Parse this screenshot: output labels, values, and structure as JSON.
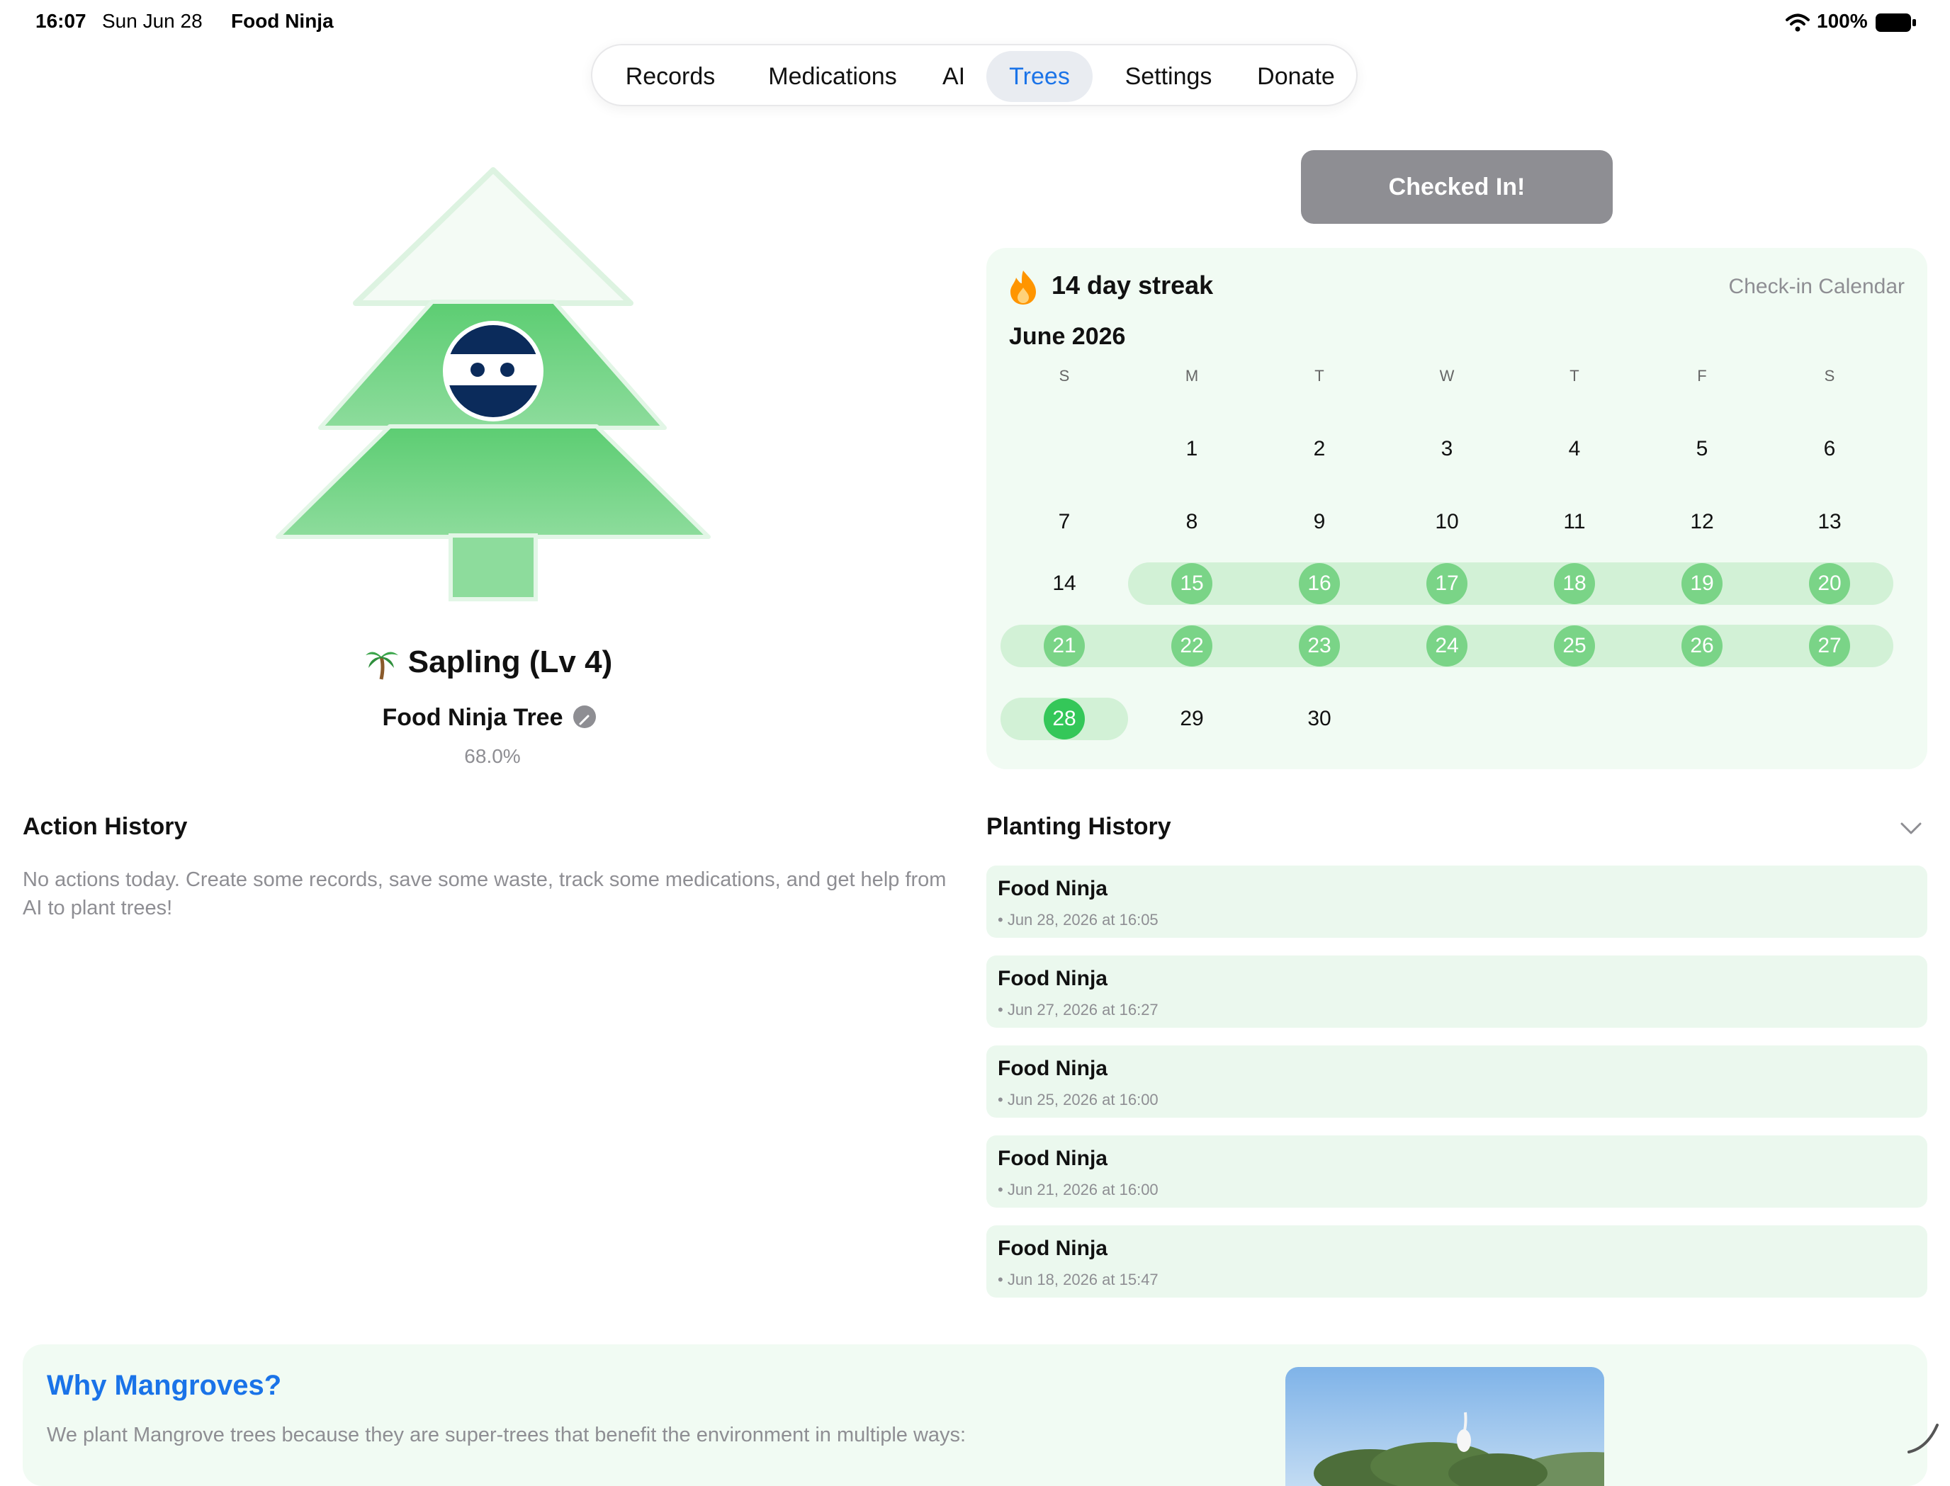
{
  "status_bar": {
    "time": "16:07",
    "date": "Sun Jun 28",
    "app_name": "Food Ninja",
    "battery": "100%"
  },
  "nav": {
    "tabs": [
      "Records",
      "Medications",
      "AI",
      "Trees",
      "Settings",
      "Donate"
    ],
    "active": "Trees"
  },
  "tree": {
    "level": "Sapling (Lv 4)",
    "name": "Food Ninja Tree",
    "progress": "68.0%",
    "icon": "palm-tree-icon"
  },
  "checkin": {
    "label": "Checked In!"
  },
  "calendar": {
    "streak": "14 day streak",
    "title": "Check-in Calendar",
    "month": "June 2026",
    "weekdays": [
      "S",
      "M",
      "T",
      "W",
      "T",
      "F",
      "S"
    ],
    "days": [
      "1",
      "2",
      "3",
      "4",
      "5",
      "6",
      "7",
      "8",
      "9",
      "10",
      "11",
      "12",
      "13",
      "14",
      "15",
      "16",
      "17",
      "18",
      "19",
      "20",
      "21",
      "22",
      "23",
      "24",
      "25",
      "26",
      "27",
      "28",
      "29",
      "30"
    ],
    "first_weekday": 1,
    "checked": [
      15,
      16,
      17,
      18,
      19,
      20,
      21,
      22,
      23,
      24,
      25,
      26,
      27,
      28
    ],
    "today": 28
  },
  "action_history": {
    "title": "Action History",
    "empty": "No actions today. Create some records, save some waste, track some medications, and get help from AI to plant trees!"
  },
  "planting_history": {
    "title": "Planting History",
    "items": [
      {
        "name": "Food Ninja",
        "date": "• Jun 28, 2026 at 16:05"
      },
      {
        "name": "Food Ninja",
        "date": "• Jun 27, 2026 at 16:27"
      },
      {
        "name": "Food Ninja",
        "date": "• Jun 25, 2026 at 16:00"
      },
      {
        "name": "Food Ninja",
        "date": "• Jun 21, 2026 at 16:00"
      },
      {
        "name": "Food Ninja",
        "date": "• Jun 18, 2026 at 15:47"
      }
    ]
  },
  "mangrove": {
    "title": "Why Mangroves?",
    "text": "We plant Mangrove trees because they are super-trees that benefit the environment in multiple ways:"
  },
  "colors": {
    "accent": "#1a73e8",
    "checked": "#7ad487",
    "today": "#34c759",
    "card": "#f1fbf3",
    "button": "#8e8e93"
  }
}
